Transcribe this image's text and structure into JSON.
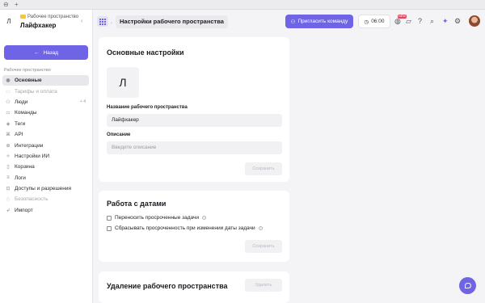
{
  "topstrip": {
    "window_icon": "⊖",
    "new_tab_icon": "+"
  },
  "sidebar": {
    "workspace_letter": "Л",
    "workspace_super": "Рабочее пространство",
    "workspace_name": "Лайфхакер",
    "back_label": "Назад",
    "section_label": "Рабочее пространство",
    "items": [
      {
        "label": "Основные",
        "icon": "circle-icon",
        "glyph": "◉",
        "active": true,
        "muted": false
      },
      {
        "label": "Тарифы и оплата",
        "icon": "card-icon",
        "glyph": "▭",
        "active": false,
        "muted": true
      },
      {
        "label": "Люди",
        "icon": "people-icon",
        "glyph": "⚇",
        "active": false,
        "muted": false,
        "extra": "+ 4"
      },
      {
        "label": "Команды",
        "icon": "team-icon",
        "glyph": "⚏",
        "active": false,
        "muted": false
      },
      {
        "label": "Теги",
        "icon": "tag-icon",
        "glyph": "◈",
        "active": false,
        "muted": false
      },
      {
        "label": "API",
        "icon": "code-icon",
        "glyph": "⌘",
        "active": false,
        "muted": false
      },
      {
        "label": "Интеграции",
        "icon": "plug-icon",
        "glyph": "⊕",
        "active": false,
        "muted": false
      },
      {
        "label": "Настройки ИИ",
        "icon": "sparkle-icon",
        "glyph": "✧",
        "active": false,
        "muted": false
      },
      {
        "label": "Корзина",
        "icon": "trash-icon",
        "glyph": "▯",
        "active": false,
        "muted": false
      },
      {
        "label": "Логи",
        "icon": "log-icon",
        "glyph": "≡",
        "active": false,
        "muted": false
      },
      {
        "label": "Доступы и разрешения",
        "icon": "lock-icon",
        "glyph": "⊡",
        "active": false,
        "muted": false
      },
      {
        "label": "Безопасность",
        "icon": "shield-icon",
        "glyph": "◇",
        "active": false,
        "muted": true
      },
      {
        "label": "Импорт",
        "icon": "import-icon",
        "glyph": "↲",
        "active": false,
        "muted": false
      }
    ]
  },
  "header": {
    "page_tab": "Настройки рабочего пространства",
    "invite_label": "Пригласить команду",
    "timer": "06:00",
    "new_badge": "NEW"
  },
  "general": {
    "title": "Основные настройки",
    "logo_letter": "Л",
    "name_label": "Название рабочего пространства",
    "name_value": "Лайфхакер",
    "desc_label": "Описание",
    "desc_placeholder": "Введите описание",
    "save_label": "Сохранить"
  },
  "dates": {
    "title": "Работа с датами",
    "option1": "Переносить просроченные задачи",
    "option2": "Сбрасывать просроченность при изменении даты задачи",
    "save_label": "Сохранить"
  },
  "delete": {
    "title": "Удаление рабочего пространства",
    "button_label": "Удалить"
  },
  "colors": {
    "accent": "#6f64e6",
    "badge": "#e4465d"
  }
}
